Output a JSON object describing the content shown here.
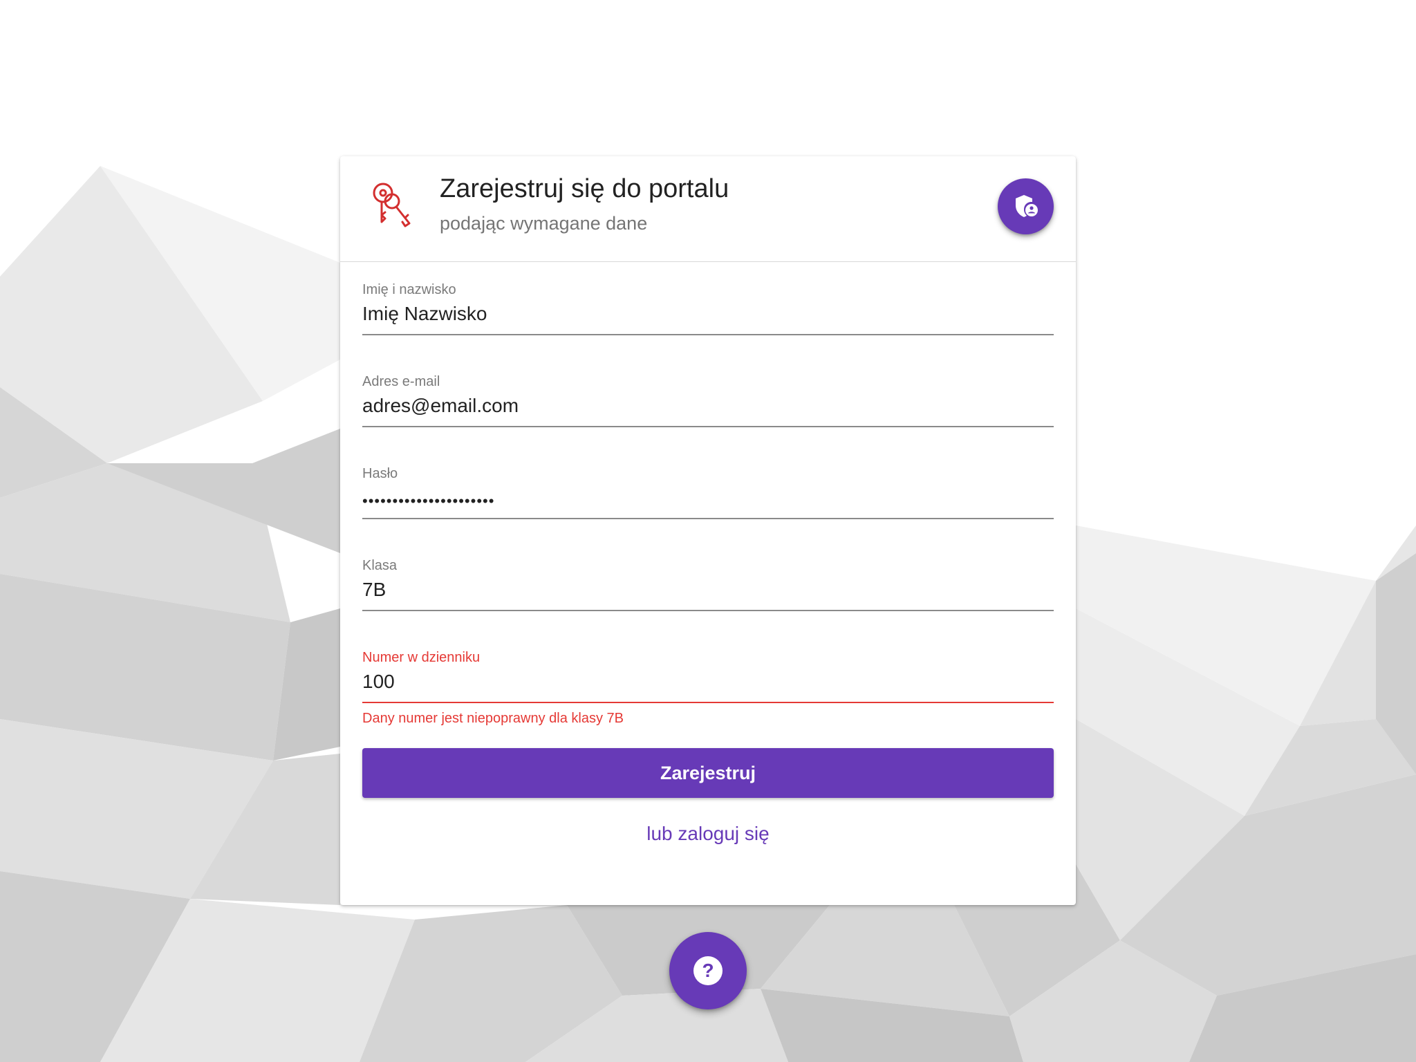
{
  "header": {
    "title": "Zarejestruj się do portalu",
    "subtitle": "podając wymagane dane",
    "icon": "keys-icon",
    "action_icon": "shield-user-icon"
  },
  "form": {
    "fields": [
      {
        "label": "Imię i nazwisko",
        "value": "Imię Nazwisko"
      },
      {
        "label": "Adres e-mail",
        "value": "adres@email.com"
      },
      {
        "label": "Hasło",
        "value": "••••••••••••••••••••••"
      },
      {
        "label": "Klasa",
        "value": "7B"
      },
      {
        "label": "Numer w dzienniku",
        "value": "100",
        "error": "Dany numer jest niepoprawny dla klasy 7B"
      }
    ],
    "submit_label": "Zarejestruj",
    "login_link": "lub zaloguj się"
  },
  "help": {
    "icon": "help-icon",
    "label": "?"
  },
  "colors": {
    "accent": "#673ab7",
    "error": "#e53935",
    "icon_red": "#d32f2f"
  }
}
